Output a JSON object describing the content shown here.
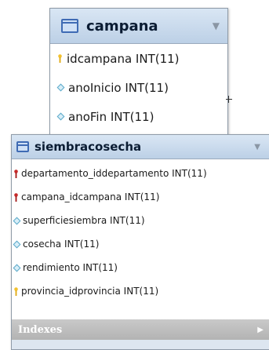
{
  "tables": [
    {
      "name": "campana",
      "columns": [
        {
          "text": "idcampana INT(11)",
          "icon": "primary-key-icon"
        },
        {
          "text": "anoInicio INT(11)",
          "icon": "column-diamond-icon"
        },
        {
          "text": "anoFin INT(11)",
          "icon": "column-diamond-icon"
        }
      ]
    },
    {
      "name": "siembracosecha",
      "columns": [
        {
          "text": "departamento_iddepartamento INT(11)",
          "icon": "foreign-key-icon"
        },
        {
          "text": "campana_idcampana INT(11)",
          "icon": "foreign-key-icon"
        },
        {
          "text": "superficiesiembra INT(11)",
          "icon": "column-diamond-icon"
        },
        {
          "text": "cosecha INT(11)",
          "icon": "column-diamond-icon"
        },
        {
          "text": "rendimiento INT(11)",
          "icon": "column-diamond-icon"
        },
        {
          "text": "provincia_idprovincia INT(11)",
          "icon": "primary-key-icon"
        }
      ],
      "indexes_label": "Indexes"
    }
  ],
  "colors": {
    "header_bg": "#c8d9ec",
    "primary_key": "#f2c12e",
    "foreign_key": "#c62828",
    "column_diamond": "#5aa9c9",
    "indexes_bg": "#bdbdbd"
  }
}
